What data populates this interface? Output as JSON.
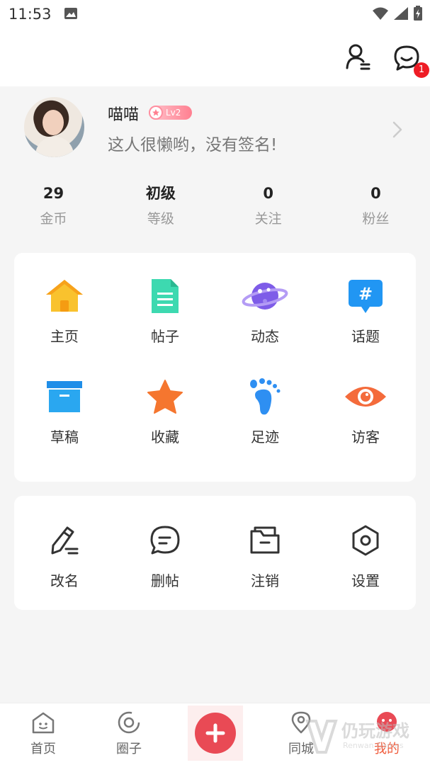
{
  "status_bar": {
    "time": "11:53",
    "icons": [
      "image-icon",
      "wifi-icon",
      "signal-icon",
      "battery-icon"
    ]
  },
  "header": {
    "message_badge": "1"
  },
  "profile": {
    "nickname": "喵喵",
    "level_badge": "Lv2",
    "signature": "这人很懒哟，没有签名!"
  },
  "stats": [
    {
      "value": "29",
      "label": "金币"
    },
    {
      "value": "初级",
      "label": "等级"
    },
    {
      "value": "0",
      "label": "关注"
    },
    {
      "value": "0",
      "label": "粉丝"
    }
  ],
  "main_grid": [
    {
      "label": "主页",
      "icon": "home-icon",
      "color": "#f7b521"
    },
    {
      "label": "帖子",
      "icon": "document-icon",
      "color": "#35d3a7"
    },
    {
      "label": "动态",
      "icon": "planet-icon",
      "color": "#7d5fe8"
    },
    {
      "label": "话题",
      "icon": "hashtag-icon",
      "color": "#2196f3"
    },
    {
      "label": "草稿",
      "icon": "archive-box-icon",
      "color": "#2aa7f0"
    },
    {
      "label": "收藏",
      "icon": "star-icon",
      "color": "#f5762f"
    },
    {
      "label": "足迹",
      "icon": "footprint-icon",
      "color": "#2e8ff2"
    },
    {
      "label": "访客",
      "icon": "eye-icon",
      "color": "#f46b3b"
    }
  ],
  "tools_grid": [
    {
      "label": "改名",
      "icon": "edit-pen-icon"
    },
    {
      "label": "删帖",
      "icon": "message-bubble-icon"
    },
    {
      "label": "注销",
      "icon": "folder-icon"
    },
    {
      "label": "设置",
      "icon": "settings-hexagon-icon"
    }
  ],
  "bottom_nav": [
    {
      "label": "首页",
      "icon": "home-outline-icon"
    },
    {
      "label": "圈子",
      "icon": "circle-icon"
    },
    {
      "label": "同城",
      "icon": "location-icon"
    },
    {
      "label": "我的",
      "icon": "profile-icon",
      "active": true
    }
  ],
  "watermark": {
    "text": "仍玩游戏",
    "sub": "Renwan Games"
  },
  "colors": {
    "accent": "#f05a3a",
    "plus": "#e94a55",
    "badge": "#ee1c25"
  }
}
